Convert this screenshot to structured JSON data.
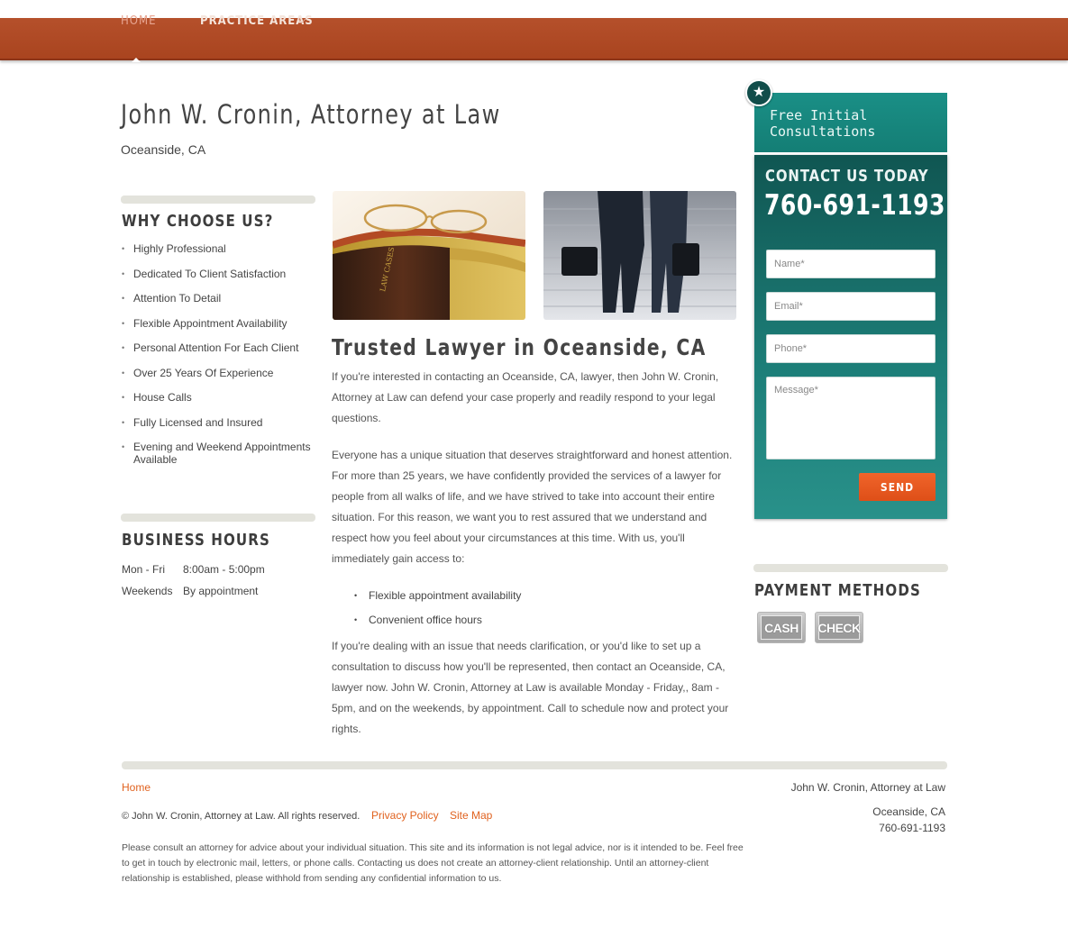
{
  "nav": {
    "items": [
      {
        "label": "HOME"
      },
      {
        "label": "PRACTICE AREAS"
      }
    ]
  },
  "header": {
    "title": "John W. Cronin, Attorney at Law",
    "location": "Oceanside, CA"
  },
  "why": {
    "heading": "WHY CHOOSE US?",
    "items": [
      "Highly Professional",
      "Dedicated To Client Satisfaction",
      "Attention To Detail",
      "Flexible Appointment Availability",
      "Personal Attention For Each Client",
      "Over 25 Years Of Experience",
      "House Calls",
      "Fully Licensed and Insured",
      "Evening and Weekend Appointments Available"
    ]
  },
  "hours": {
    "heading": "BUSINESS HOURS",
    "rows": [
      {
        "day": "Mon - Fri",
        "time": "8:00am - 5:00pm"
      },
      {
        "day": "Weekends",
        "time": "By appointment"
      }
    ]
  },
  "main": {
    "heading": "Trusted Lawyer in Oceanside, CA",
    "para1": "If you're interested in contacting an Oceanside, CA, lawyer, then John W. Cronin, Attorney at Law can defend your case properly and readily respond to your legal questions.",
    "para2": "Everyone has a unique situation that deserves straightforward and honest attention. For more than 25 years, we have confidently provided the services of a lawyer for people from all walks of life, and we have strived to take into account their entire situation. For this reason, we want you to rest assured that we understand and respect how you feel about your circumstances at this time. With us, you'll immediately gain access to:",
    "bullets": [
      "Flexible appointment availability",
      "Convenient office hours"
    ],
    "para3": "If you're dealing with an issue that needs clarification, or you'd like to set up a consultation to discuss how you'll be represented, then contact an Oceanside, CA, lawyer now. John W. Cronin, Attorney at Law is available Monday - Friday,, 8am - 5pm, and on the weekends, by appointment. Call to schedule now and protect your rights."
  },
  "sidebar": {
    "banner": "Free Initial Consultations",
    "contact_heading": "CONTACT US TODAY",
    "phone": "760-691-1193",
    "form": {
      "name_placeholder": "Name*",
      "email_placeholder": "Email*",
      "phone_placeholder": "Phone*",
      "message_placeholder": "Message*",
      "send_label": "SEND"
    },
    "payment_heading": "PAYMENT METHODS",
    "payment_methods": [
      "CASH",
      "CHECK"
    ]
  },
  "footer": {
    "home_link": "Home",
    "copyright": "© John W. Cronin, Attorney at Law. All rights reserved.",
    "privacy_link": "Privacy Policy",
    "sitemap_link": "Site Map",
    "firm_name": "John W. Cronin, Attorney at Law",
    "city": "Oceanside, CA",
    "phone": "760-691-1193",
    "disclaimer": "Please consult an attorney for advice about your individual situation. This site and its information is not legal advice, nor is it intended to be. Feel free to get in touch by electronic mail, letters, or phone calls. Contacting us does not create an attorney-client relationship. Until an attorney-client relationship is established, please withhold from sending any confidential information to us."
  },
  "colors": {
    "nav": "#ab4621",
    "accent": "#e0621f",
    "teal": "#1a8f86",
    "dark_teal": "#105652"
  }
}
